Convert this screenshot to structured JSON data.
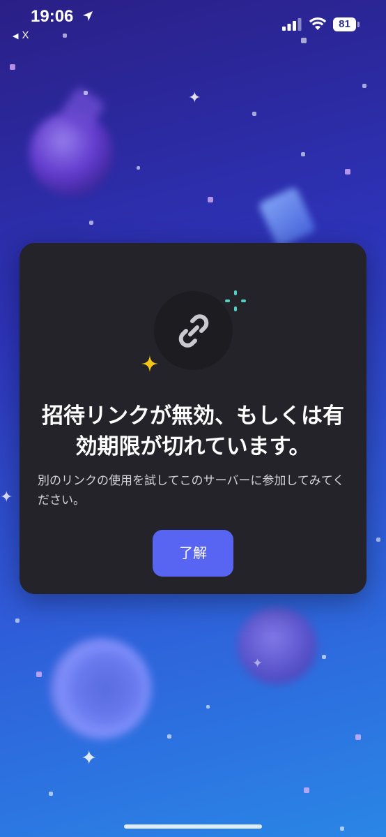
{
  "status_bar": {
    "time": "19:06",
    "back_app": "X",
    "battery": "81"
  },
  "dialog": {
    "title": "招待リンクが無効、もしくは有効期限が切れています。",
    "body": "別のリンクの使用を試してこのサーバーに参加してみてください。",
    "confirm_label": "了解",
    "icon": "link-icon"
  },
  "colors": {
    "dialog_bg": "#232329",
    "button_bg": "#5865f2",
    "sparkle_yellow": "#f5c518",
    "sparkle_teal": "#4fd1c5"
  }
}
